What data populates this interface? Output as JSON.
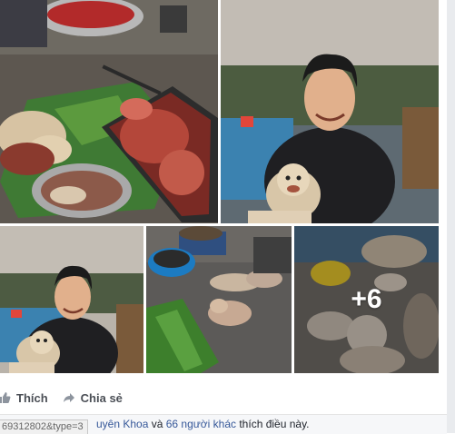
{
  "photos": {
    "overlay_more": "+6"
  },
  "actions": {
    "like_label": "Thích",
    "share_label": "Chia sẻ"
  },
  "likes": {
    "name": "uyên Khoa",
    "and": " và ",
    "others_link": "66 người khác",
    "suffix": " thích điều này."
  },
  "status_bar": {
    "url_text": "69312802&type=3"
  },
  "colors": {
    "link": "#365899",
    "action_text": "#4b4f56"
  }
}
